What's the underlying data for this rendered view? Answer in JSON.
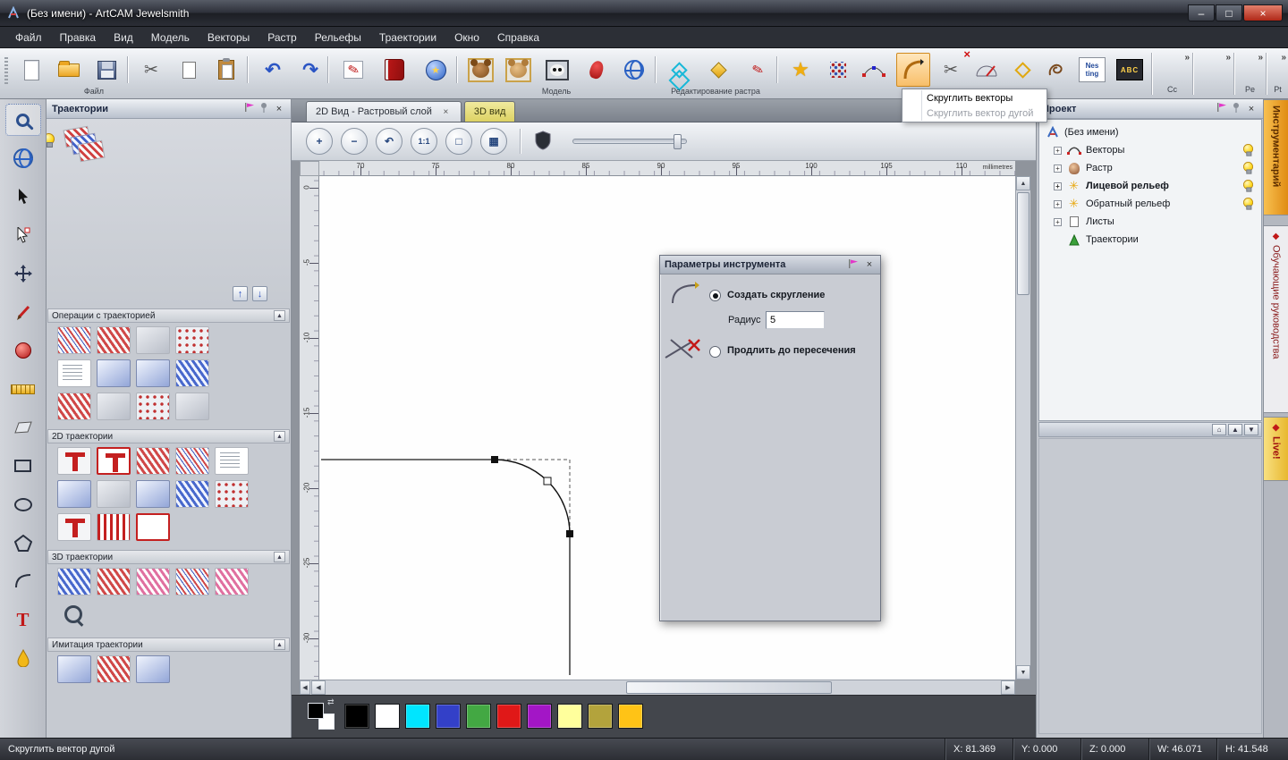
{
  "window": {
    "title": "(Без имени) - ArtCAM Jewelsmith"
  },
  "glyphs": {
    "close": "×",
    "minimize": "–",
    "maximize": "□",
    "collapse": "▲",
    "expand": "+",
    "overflow": "»",
    "up": "▲",
    "down": "▼",
    "left": "◀",
    "right": "▶",
    "arrow_up": "↑",
    "arrow_down": "↓",
    "home": "⌂",
    "swap": "⇄",
    "scissors": "✂",
    "undo": "↶",
    "redo": "↷",
    "star": "★",
    "diamond": "◆",
    "pencil": "✎",
    "text_tool": "T"
  },
  "menubar": {
    "items": [
      "Файл",
      "Правка",
      "Вид",
      "Модель",
      "Векторы",
      "Растр",
      "Рельефы",
      "Траектории",
      "Окно",
      "Справка"
    ]
  },
  "toolbar": {
    "label_file": "Файл",
    "label_model": "Модель",
    "label_raster": "Редактирование растра",
    "overflow": [
      "Cc",
      "Pe",
      "Pt"
    ],
    "nesting_line1": "Nes",
    "nesting_line2": "ting",
    "abc_label": "ABC"
  },
  "fillet_menu": {
    "items": [
      "Скруглить векторы",
      "Скруглить вектор дугой"
    ]
  },
  "left_panel": {
    "title": "Траектории",
    "sections": [
      "Операции с траекторией",
      "2D траектории",
      "3D траектории",
      "Имитация траектории"
    ]
  },
  "view": {
    "tab_2d": "2D Вид - Растровый слой",
    "tab_3d": "3D вид",
    "zoom_glyphs": [
      "+",
      "−",
      "↶",
      "1:1",
      "□",
      "▦"
    ],
    "ruler_top": [
      "70",
      "75",
      "80",
      "85",
      "90",
      "95",
      "100",
      "105",
      "110"
    ],
    "ruler_unit": "millimetres",
    "ruler_left": [
      "0",
      "-5",
      "-10",
      "-15",
      "-20",
      "-25",
      "-30"
    ]
  },
  "palette": {
    "primary": "#000000",
    "secondary": "#ffffff",
    "colors": [
      "#000000",
      "#ffffff",
      "#00e5ff",
      "#3340c8",
      "#43a843",
      "#e01818",
      "#a316c6",
      "#ffff9c",
      "#b3a33c",
      "#ffc316"
    ]
  },
  "tool_dialog": {
    "title": "Параметры инструмента",
    "option_create": "Создать скругление",
    "radius_label": "Радиус",
    "radius_value": "5",
    "option_extend": "Продлить до пересечения"
  },
  "project": {
    "title": "Проект",
    "tree": [
      {
        "label": "(Без имени)"
      },
      {
        "label": "Векторы"
      },
      {
        "label": "Растр"
      },
      {
        "label": "Лицевой рельеф"
      },
      {
        "label": "Обратный рельеф"
      },
      {
        "label": "Листы"
      },
      {
        "label": "Траектории"
      }
    ]
  },
  "right_tabs": [
    "Инструментарий",
    "Обучающие руководства",
    "Live!"
  ],
  "statusbar": {
    "message": "Скруглить вектор дугой",
    "coords": [
      "X: 81.369",
      "Y: 0.000",
      "Z: 0.000",
      "W: 46.071",
      "H: 41.548"
    ]
  }
}
